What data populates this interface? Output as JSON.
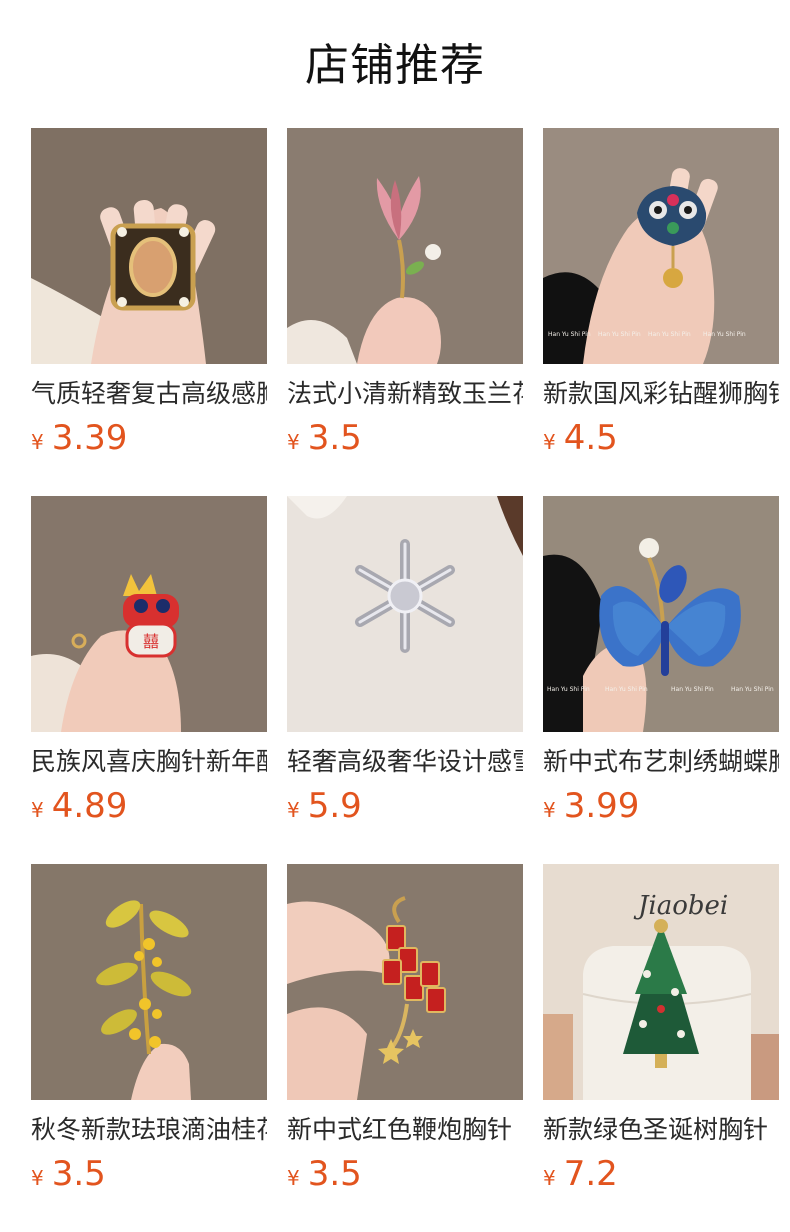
{
  "header": {
    "title": "店铺推荐"
  },
  "products": [
    {
      "name": "气质轻奢复古高级感胸针",
      "currency": "¥",
      "price": "3.39",
      "image": "vintage-gold-brooch-photo"
    },
    {
      "name": "法式小清新精致玉兰花胸针",
      "currency": "¥",
      "price": "3.5",
      "image": "magnolia-flower-brooch-photo"
    },
    {
      "name": "新款国风彩钻醒狮胸针",
      "currency": "¥",
      "price": "4.5",
      "image": "lion-dance-brooch-photo"
    },
    {
      "name": "民族风喜庆胸针新年醒狮",
      "currency": "¥",
      "price": "4.89",
      "image": "festive-lion-brooch-photo"
    },
    {
      "name": "轻奢高级奢华设计感雪花胸针",
      "currency": "¥",
      "price": "5.9",
      "image": "snowflake-brooch-photo"
    },
    {
      "name": "新中式布艺刺绣蝴蝶胸针",
      "currency": "¥",
      "price": "3.99",
      "image": "blue-butterfly-brooch-photo"
    },
    {
      "name": "秋冬新款珐琅滴油桂花胸针",
      "currency": "¥",
      "price": "3.5",
      "image": "osmanthus-brooch-photo"
    },
    {
      "name": "新中式红色鞭炮胸针",
      "currency": "¥",
      "price": "3.5",
      "image": "firecracker-brooch-photo"
    },
    {
      "name": "新款绿色圣诞树胸针",
      "currency": "¥",
      "price": "7.2",
      "image": "christmas-tree-brooch-photo"
    }
  ],
  "watermark": "Han Yu Shi Pin",
  "box_signature": "Jiaobei",
  "colors": {
    "price": "#e2541e",
    "photo_background": "#7e7166"
  }
}
